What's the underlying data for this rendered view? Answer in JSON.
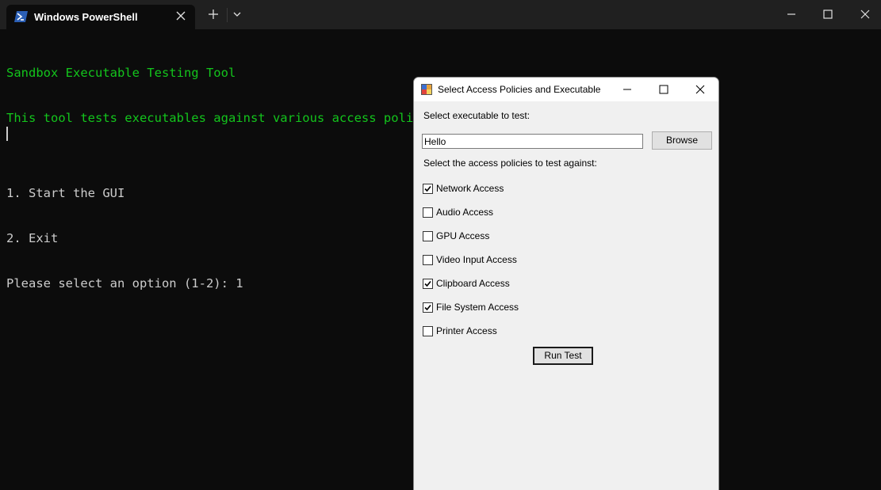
{
  "terminal": {
    "tab_title": "Windows PowerShell",
    "lines": [
      {
        "text": "Sandbox Executable Testing Tool",
        "color": "green"
      },
      {
        "text": "This tool tests executables against various access policies in a Windows Sandbox environment.",
        "color": "green"
      },
      {
        "text": "",
        "color": "white"
      },
      {
        "text": "1. Start the GUI",
        "color": "white"
      },
      {
        "text": "2. Exit",
        "color": "white"
      },
      {
        "text": "Please select an option (1-2): 1",
        "color": "white"
      }
    ]
  },
  "dialog": {
    "title": "Select Access Policies and Executable",
    "exe_label": "Select executable to test:",
    "exe_value": "Hello",
    "browse_label": "Browse",
    "policies_label": "Select the access policies to test against:",
    "policies": [
      {
        "label": "Network Access",
        "checked": true
      },
      {
        "label": "Audio Access",
        "checked": false
      },
      {
        "label": "GPU Access",
        "checked": false
      },
      {
        "label": "Video Input Access",
        "checked": false
      },
      {
        "label": "Clipboard Access",
        "checked": true
      },
      {
        "label": "File System Access",
        "checked": true
      },
      {
        "label": "Printer Access",
        "checked": false
      }
    ],
    "run_label": "Run Test"
  },
  "colors": {
    "terminal_bg": "#0c0c0c",
    "terminal_green": "#13c51c",
    "terminal_text": "#cccccc"
  }
}
